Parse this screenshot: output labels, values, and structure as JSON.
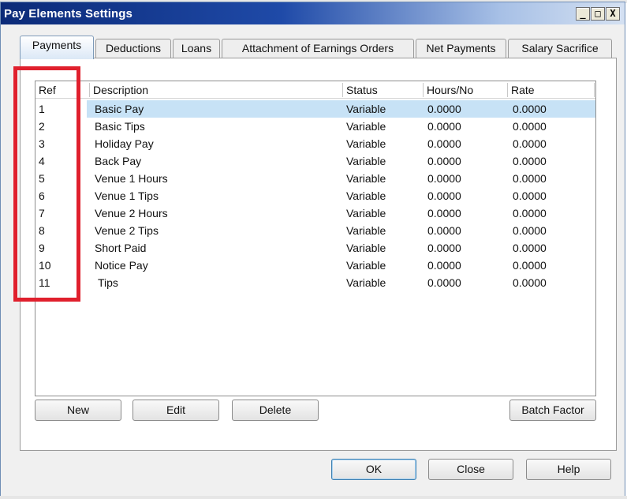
{
  "window": {
    "title": "Pay Elements Settings",
    "controls": [
      "_",
      "□",
      "X"
    ]
  },
  "tabs": [
    {
      "label": "Payments",
      "active": true
    },
    {
      "label": "Deductions",
      "active": false
    },
    {
      "label": "Loans",
      "active": false
    },
    {
      "label": "Attachment of Earnings Orders",
      "active": false
    },
    {
      "label": "Net Payments",
      "active": false
    },
    {
      "label": "Salary Sacrifice",
      "active": false
    }
  ],
  "table": {
    "columns": [
      "Ref",
      "Description",
      "Status",
      "Hours/No",
      "Rate"
    ],
    "rows": [
      {
        "ref": "1",
        "description": "Basic Pay",
        "status": "Variable",
        "hours": "0.0000",
        "rate": "0.0000"
      },
      {
        "ref": "2",
        "description": "Basic Tips",
        "status": "Variable",
        "hours": "0.0000",
        "rate": "0.0000"
      },
      {
        "ref": "3",
        "description": "Holiday Pay",
        "status": "Variable",
        "hours": "0.0000",
        "rate": "0.0000"
      },
      {
        "ref": "4",
        "description": "Back Pay",
        "status": "Variable",
        "hours": "0.0000",
        "rate": "0.0000"
      },
      {
        "ref": "5",
        "description": "Venue 1 Hours",
        "status": "Variable",
        "hours": "0.0000",
        "rate": "0.0000"
      },
      {
        "ref": "6",
        "description": "Venue 1 Tips",
        "status": "Variable",
        "hours": "0.0000",
        "rate": "0.0000"
      },
      {
        "ref": "7",
        "description": "Venue 2 Hours",
        "status": "Variable",
        "hours": "0.0000",
        "rate": "0.0000"
      },
      {
        "ref": "8",
        "description": "Venue 2 Tips",
        "status": "Variable",
        "hours": "0.0000",
        "rate": "0.0000"
      },
      {
        "ref": "9",
        "description": "Short Paid",
        "status": "Variable",
        "hours": "0.0000",
        "rate": "0.0000"
      },
      {
        "ref": "10",
        "description": "Notice Pay",
        "status": "Variable",
        "hours": "0.0000",
        "rate": "0.0000"
      },
      {
        "ref": "11",
        "description": "Tips",
        "status": "Variable",
        "hours": "0.0000",
        "rate": "0.0000"
      }
    ]
  },
  "panel_buttons": {
    "new": "New",
    "edit": "Edit",
    "delete": "Delete",
    "batch_factor": "Batch Factor"
  },
  "dialog_buttons": {
    "ok": "OK",
    "close": "Close",
    "help": "Help"
  },
  "colors": {
    "highlight": "#e0202d",
    "selection": "#c7e2f6",
    "title_bar": "#0b2a78"
  }
}
